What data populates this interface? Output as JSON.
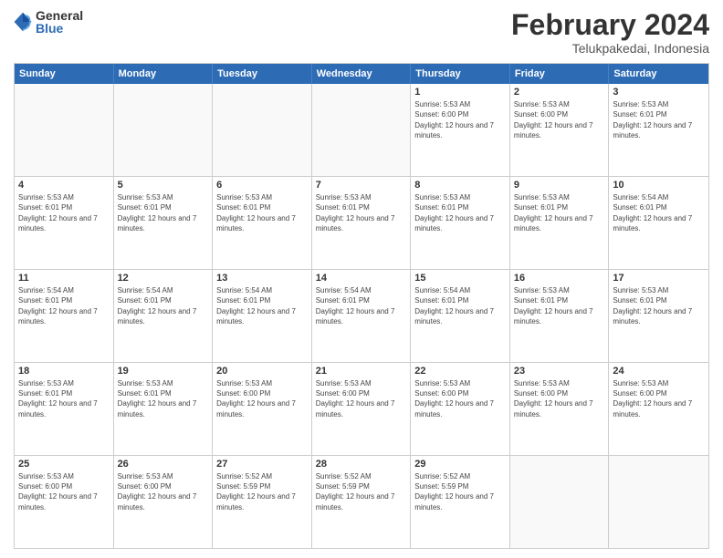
{
  "header": {
    "logo": {
      "general": "General",
      "blue": "Blue"
    },
    "title": "February 2024",
    "subtitle": "Telukpakedai, Indonesia"
  },
  "weekdays": [
    "Sunday",
    "Monday",
    "Tuesday",
    "Wednesday",
    "Thursday",
    "Friday",
    "Saturday"
  ],
  "rows": [
    [
      {
        "day": "",
        "empty": true
      },
      {
        "day": "",
        "empty": true
      },
      {
        "day": "",
        "empty": true
      },
      {
        "day": "",
        "empty": true
      },
      {
        "day": "1",
        "sunrise": "5:53 AM",
        "sunset": "6:00 PM",
        "daylight": "12 hours and 7 minutes."
      },
      {
        "day": "2",
        "sunrise": "5:53 AM",
        "sunset": "6:00 PM",
        "daylight": "12 hours and 7 minutes."
      },
      {
        "day": "3",
        "sunrise": "5:53 AM",
        "sunset": "6:01 PM",
        "daylight": "12 hours and 7 minutes."
      }
    ],
    [
      {
        "day": "4",
        "sunrise": "5:53 AM",
        "sunset": "6:01 PM",
        "daylight": "12 hours and 7 minutes."
      },
      {
        "day": "5",
        "sunrise": "5:53 AM",
        "sunset": "6:01 PM",
        "daylight": "12 hours and 7 minutes."
      },
      {
        "day": "6",
        "sunrise": "5:53 AM",
        "sunset": "6:01 PM",
        "daylight": "12 hours and 7 minutes."
      },
      {
        "day": "7",
        "sunrise": "5:53 AM",
        "sunset": "6:01 PM",
        "daylight": "12 hours and 7 minutes."
      },
      {
        "day": "8",
        "sunrise": "5:53 AM",
        "sunset": "6:01 PM",
        "daylight": "12 hours and 7 minutes."
      },
      {
        "day": "9",
        "sunrise": "5:53 AM",
        "sunset": "6:01 PM",
        "daylight": "12 hours and 7 minutes."
      },
      {
        "day": "10",
        "sunrise": "5:54 AM",
        "sunset": "6:01 PM",
        "daylight": "12 hours and 7 minutes."
      }
    ],
    [
      {
        "day": "11",
        "sunrise": "5:54 AM",
        "sunset": "6:01 PM",
        "daylight": "12 hours and 7 minutes."
      },
      {
        "day": "12",
        "sunrise": "5:54 AM",
        "sunset": "6:01 PM",
        "daylight": "12 hours and 7 minutes."
      },
      {
        "day": "13",
        "sunrise": "5:54 AM",
        "sunset": "6:01 PM",
        "daylight": "12 hours and 7 minutes."
      },
      {
        "day": "14",
        "sunrise": "5:54 AM",
        "sunset": "6:01 PM",
        "daylight": "12 hours and 7 minutes."
      },
      {
        "day": "15",
        "sunrise": "5:54 AM",
        "sunset": "6:01 PM",
        "daylight": "12 hours and 7 minutes."
      },
      {
        "day": "16",
        "sunrise": "5:53 AM",
        "sunset": "6:01 PM",
        "daylight": "12 hours and 7 minutes."
      },
      {
        "day": "17",
        "sunrise": "5:53 AM",
        "sunset": "6:01 PM",
        "daylight": "12 hours and 7 minutes."
      }
    ],
    [
      {
        "day": "18",
        "sunrise": "5:53 AM",
        "sunset": "6:01 PM",
        "daylight": "12 hours and 7 minutes."
      },
      {
        "day": "19",
        "sunrise": "5:53 AM",
        "sunset": "6:01 PM",
        "daylight": "12 hours and 7 minutes."
      },
      {
        "day": "20",
        "sunrise": "5:53 AM",
        "sunset": "6:00 PM",
        "daylight": "12 hours and 7 minutes."
      },
      {
        "day": "21",
        "sunrise": "5:53 AM",
        "sunset": "6:00 PM",
        "daylight": "12 hours and 7 minutes."
      },
      {
        "day": "22",
        "sunrise": "5:53 AM",
        "sunset": "6:00 PM",
        "daylight": "12 hours and 7 minutes."
      },
      {
        "day": "23",
        "sunrise": "5:53 AM",
        "sunset": "6:00 PM",
        "daylight": "12 hours and 7 minutes."
      },
      {
        "day": "24",
        "sunrise": "5:53 AM",
        "sunset": "6:00 PM",
        "daylight": "12 hours and 7 minutes."
      }
    ],
    [
      {
        "day": "25",
        "sunrise": "5:53 AM",
        "sunset": "6:00 PM",
        "daylight": "12 hours and 7 minutes."
      },
      {
        "day": "26",
        "sunrise": "5:53 AM",
        "sunset": "6:00 PM",
        "daylight": "12 hours and 7 minutes."
      },
      {
        "day": "27",
        "sunrise": "5:52 AM",
        "sunset": "5:59 PM",
        "daylight": "12 hours and 7 minutes."
      },
      {
        "day": "28",
        "sunrise": "5:52 AM",
        "sunset": "5:59 PM",
        "daylight": "12 hours and 7 minutes."
      },
      {
        "day": "29",
        "sunrise": "5:52 AM",
        "sunset": "5:59 PM",
        "daylight": "12 hours and 7 minutes."
      },
      {
        "day": "",
        "empty": true
      },
      {
        "day": "",
        "empty": true
      }
    ]
  ],
  "labels": {
    "sunrise": "Sunrise:",
    "sunset": "Sunset:",
    "daylight": "Daylight:"
  }
}
